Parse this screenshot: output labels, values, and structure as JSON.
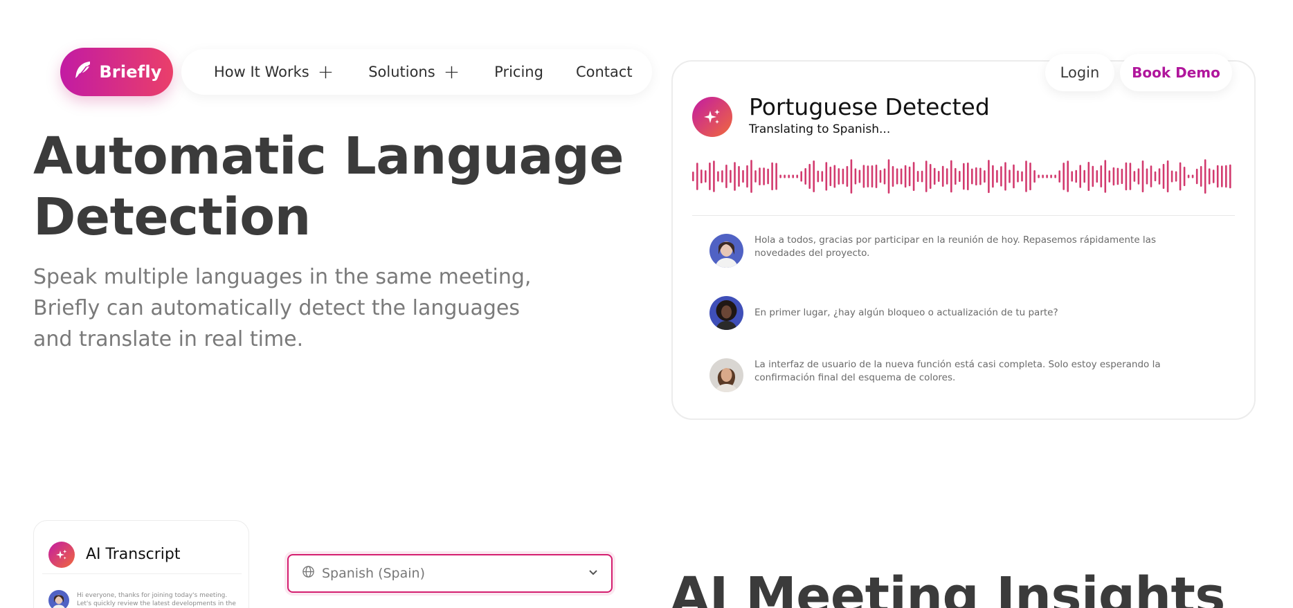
{
  "nav": {
    "logo_text": "Briefly",
    "items": [
      {
        "label": "How It Works",
        "expandable": true
      },
      {
        "label": "Solutions",
        "expandable": true
      },
      {
        "label": "Pricing",
        "expandable": false
      },
      {
        "label": "Contact",
        "expandable": false
      }
    ],
    "login_label": "Login",
    "demo_label": "Book Demo"
  },
  "hero": {
    "title": "Automatic Language Detection",
    "subtitle": "Speak multiple languages in the same meeting, Briefly can automatically detect the languages and translate in real time."
  },
  "detect_card": {
    "icon": "sparkle-icon",
    "title": "Portuguese Detected",
    "subtitle": "Translating to Spanish...",
    "messages": [
      {
        "text": "Hola a todos, gracias por participar en la reunión de hoy. Repasemos rápidamente las novedades del proyecto."
      },
      {
        "text": "En primer lugar, ¿hay algún bloqueo o actualización de tu parte?"
      },
      {
        "text": "La interfaz de usuario de la nueva función está casi completa. Solo estoy esperando la confirmación final del esquema de colores."
      }
    ]
  },
  "transcript_card": {
    "title": "AI Transcript",
    "message": "Hi everyone, thanks for joining today's meeting. Let's quickly review the latest developments in the project."
  },
  "language_select": {
    "icon": "globe-icon",
    "value": "Spanish (Spain)"
  },
  "section2": {
    "title": "AI Meeting Insights"
  },
  "colors": {
    "brand_start": "#c21ba3",
    "brand_end": "#ea3f6a",
    "waveform": "#d23a6e",
    "accent_text": "#b0169c"
  }
}
